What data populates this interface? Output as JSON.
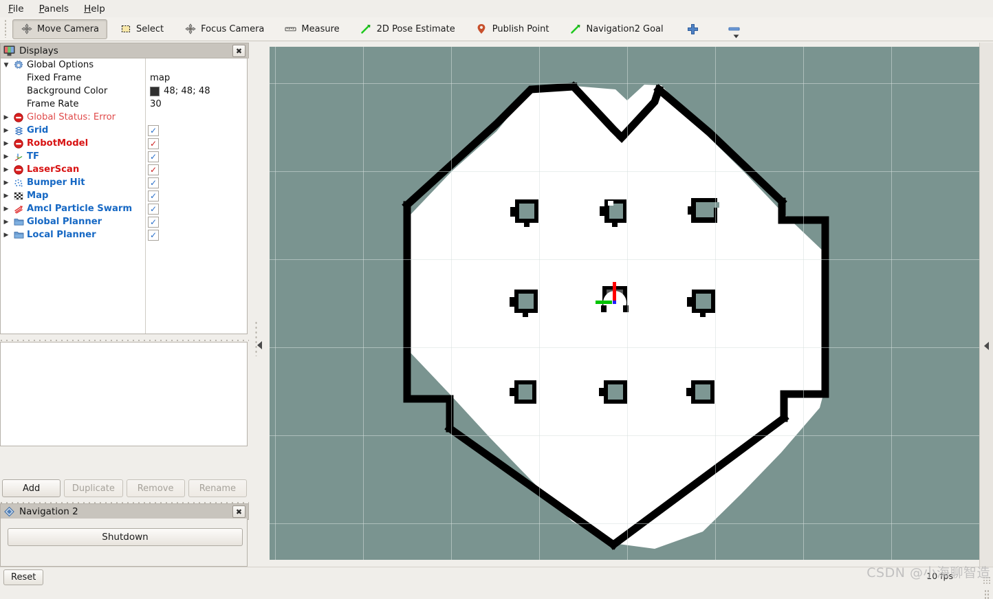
{
  "menubar": {
    "items": [
      {
        "name": "file",
        "label": "File",
        "accel": "F"
      },
      {
        "name": "panels",
        "label": "Panels",
        "accel": "P"
      },
      {
        "name": "help",
        "label": "Help",
        "accel": "H"
      }
    ]
  },
  "toolbar": {
    "tools": [
      {
        "name": "move-camera",
        "label": "Move Camera",
        "icon": "move-camera-icon",
        "active": true
      },
      {
        "name": "select",
        "label": "Select",
        "icon": "select-icon",
        "active": false
      },
      {
        "name": "focus-camera",
        "label": "Focus Camera",
        "icon": "focus-camera-icon",
        "active": false
      },
      {
        "name": "measure",
        "label": "Measure",
        "icon": "measure-icon",
        "active": false
      },
      {
        "name": "2d-pose-estimate",
        "label": "2D Pose Estimate",
        "icon": "pose-arrow-icon",
        "active": false
      },
      {
        "name": "publish-point",
        "label": "Publish Point",
        "icon": "map-pin-icon",
        "active": false
      },
      {
        "name": "navigation2-goal",
        "label": "Navigation2 Goal",
        "icon": "pose-arrow-icon",
        "active": false
      }
    ],
    "add_tool_icon": "plus-icon",
    "remove_tool_icon": "minus-icon",
    "overflow_icon": "chevron-down-icon"
  },
  "displays_panel": {
    "title": "Displays",
    "title_icon": "monitor-icon",
    "close_icon": "close-icon",
    "rows": [
      {
        "name": "global-options",
        "label": "Global Options",
        "style": "plain",
        "icon": "gear-icon",
        "arrow": "down",
        "indent": 0
      },
      {
        "name": "fixed-frame",
        "label": "Fixed Frame",
        "style": "plain",
        "icon": "none",
        "arrow": "none",
        "indent": 1,
        "value": "map"
      },
      {
        "name": "background-color",
        "label": "Background Color",
        "style": "plain",
        "icon": "none",
        "arrow": "none",
        "indent": 1,
        "value": "48; 48; 48",
        "swatch": "#303030"
      },
      {
        "name": "frame-rate",
        "label": "Frame Rate",
        "style": "plain",
        "icon": "none",
        "arrow": "none",
        "indent": 1,
        "value": "30"
      },
      {
        "name": "global-status",
        "label": "Global Status: Error",
        "style": "errlight",
        "icon": "error-icon",
        "arrow": "right",
        "indent": 0
      },
      {
        "name": "grid",
        "label": "Grid",
        "style": "blue",
        "icon": "grid-icon",
        "arrow": "right",
        "indent": 0,
        "checked": true,
        "check_color": "blue"
      },
      {
        "name": "robotmodel",
        "label": "RobotModel",
        "style": "err",
        "icon": "error-icon",
        "arrow": "right",
        "indent": 0,
        "checked": true,
        "check_color": "red"
      },
      {
        "name": "tf",
        "label": "TF",
        "style": "blue",
        "icon": "axes-icon",
        "arrow": "right",
        "indent": 0,
        "checked": true,
        "check_color": "blue"
      },
      {
        "name": "laserscan",
        "label": "LaserScan",
        "style": "err",
        "icon": "error-icon",
        "arrow": "right",
        "indent": 0,
        "checked": true,
        "check_color": "red"
      },
      {
        "name": "bumper-hit",
        "label": "Bumper Hit",
        "style": "blue",
        "icon": "pointcloud-icon",
        "arrow": "right",
        "indent": 0,
        "checked": true,
        "check_color": "blue"
      },
      {
        "name": "map",
        "label": "Map",
        "style": "blue",
        "icon": "map-grid-icon",
        "arrow": "right",
        "indent": 0,
        "checked": true,
        "check_color": "blue"
      },
      {
        "name": "amcl-particle-swarm",
        "label": "Amcl Particle Swarm",
        "style": "blue",
        "icon": "pose-array-icon",
        "arrow": "right",
        "indent": 0,
        "checked": true,
        "check_color": "blue"
      },
      {
        "name": "global-planner",
        "label": "Global Planner",
        "style": "blue",
        "icon": "folder-icon",
        "arrow": "right",
        "indent": 0,
        "checked": true,
        "check_color": "blue"
      },
      {
        "name": "local-planner",
        "label": "Local Planner",
        "style": "blue",
        "icon": "folder-icon",
        "arrow": "right",
        "indent": 0,
        "checked": true,
        "check_color": "blue"
      }
    ],
    "buttons": [
      {
        "name": "add-button",
        "label": "Add",
        "disabled": false
      },
      {
        "name": "duplicate-button",
        "label": "Duplicate",
        "disabled": true
      },
      {
        "name": "remove-button",
        "label": "Remove",
        "disabled": true
      },
      {
        "name": "rename-button",
        "label": "Rename",
        "disabled": true
      }
    ]
  },
  "navigation2_panel": {
    "title": "Navigation 2",
    "title_icon": "nav2-diamond-icon",
    "close_icon": "close-icon",
    "shutdown_label": "Shutdown"
  },
  "statusbar": {
    "reset_label": "Reset",
    "fps": "10 fps",
    "watermark": "CSDN @小海聊智造"
  },
  "viewport": {
    "background_color": "#7a9490",
    "free_space_color": "#ffffff",
    "occupied_color": "#000000",
    "grid_color": "#d7e0de",
    "robot": {
      "name": "robot-pose-marker",
      "x_axis_color": "#ff0000",
      "y_axis_color": "#00c000",
      "origin_color": "#2020ff"
    }
  }
}
